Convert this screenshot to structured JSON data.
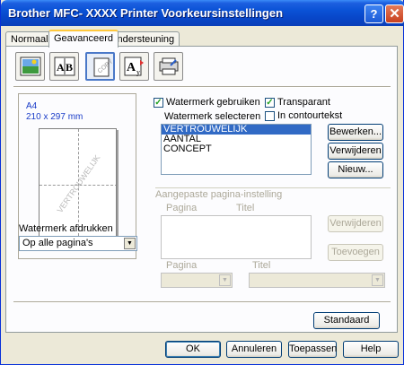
{
  "window": {
    "title": "Brother MFC- XXXX   Printer Voorkeursinstellingen",
    "help_label": "?",
    "close_label": "✕"
  },
  "tabs": [
    {
      "label": "Normaal"
    },
    {
      "label": "Geavanceerd"
    },
    {
      "label": "Ondersteuning"
    }
  ],
  "icons": [
    "color-icon",
    "scaling-icon",
    "watermark-icon",
    "text-format-icon",
    "device-options-icon"
  ],
  "preview": {
    "paper": "A4",
    "size": "210 x 297 mm",
    "watermark_text": "VERTROUWELIJK"
  },
  "watermark_print": {
    "label": "Watermerk afdrukken",
    "value": "Op alle pagina's"
  },
  "use_watermark": {
    "label": "Watermerk gebruiken",
    "checked": true
  },
  "transparent": {
    "label": "Transparant",
    "checked": true
  },
  "outline_text": {
    "label": "In contourtekst",
    "checked": false
  },
  "select_label": "Watermerk selecteren",
  "watermarks": [
    "VERTROUWELIJK",
    "AANTAL",
    "CONCEPT"
  ],
  "selected_index": 0,
  "buttons": {
    "edit": "Bewerken...",
    "delete": "Verwijderen",
    "new": "Nieuw..."
  },
  "custom": {
    "title": "Aangepaste pagina-instelling",
    "col_page": "Pagina",
    "col_title": "Titel",
    "delete": "Verwijderen",
    "add": "Toevoegen",
    "page_label": "Pagina",
    "title_label": "Titel"
  },
  "default_button": "Standaard",
  "footer": {
    "ok": "OK",
    "cancel": "Annuleren",
    "apply": "Toepassen",
    "help": "Help"
  },
  "colors": {
    "titlebar": "#0A52D6",
    "selection": "#316AC5",
    "preview_text": "#1A3CC8",
    "tab_highlight": "#FFC83C"
  }
}
